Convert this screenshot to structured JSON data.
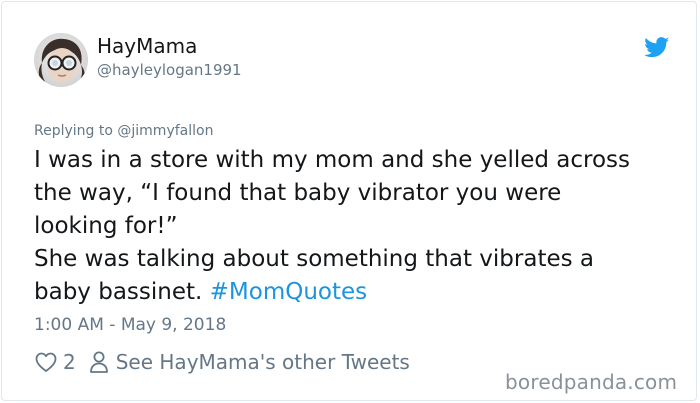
{
  "tweet": {
    "display_name": "HayMama",
    "handle": "@hayleylogan1991",
    "replying_prefix": "Replying to ",
    "replying_mention": "@jimmyfallon",
    "text_lines": [
      "I was in a store with my mom and she yelled across",
      "the way, “I found that baby vibrator you were",
      "looking for!”",
      "She was talking about something that vibrates a",
      "baby bassinet. "
    ],
    "hashtag": "#MomQuotes",
    "timestamp": "1:00 AM - May 9, 2018",
    "likes": "2",
    "other_tweets_label": "See HayMama's other Tweets"
  },
  "icons": {
    "platform": "twitter-bird-icon",
    "like": "heart-outline-icon",
    "profile": "person-outline-icon"
  },
  "colors": {
    "twitter_blue": "#1da1f2",
    "hashtag": "#1b95e0",
    "secondary_text": "#657786",
    "primary_text": "#14171a",
    "border": "#e1e8ed",
    "watermark": "#8a9199"
  },
  "watermark": "boredpanda.com"
}
